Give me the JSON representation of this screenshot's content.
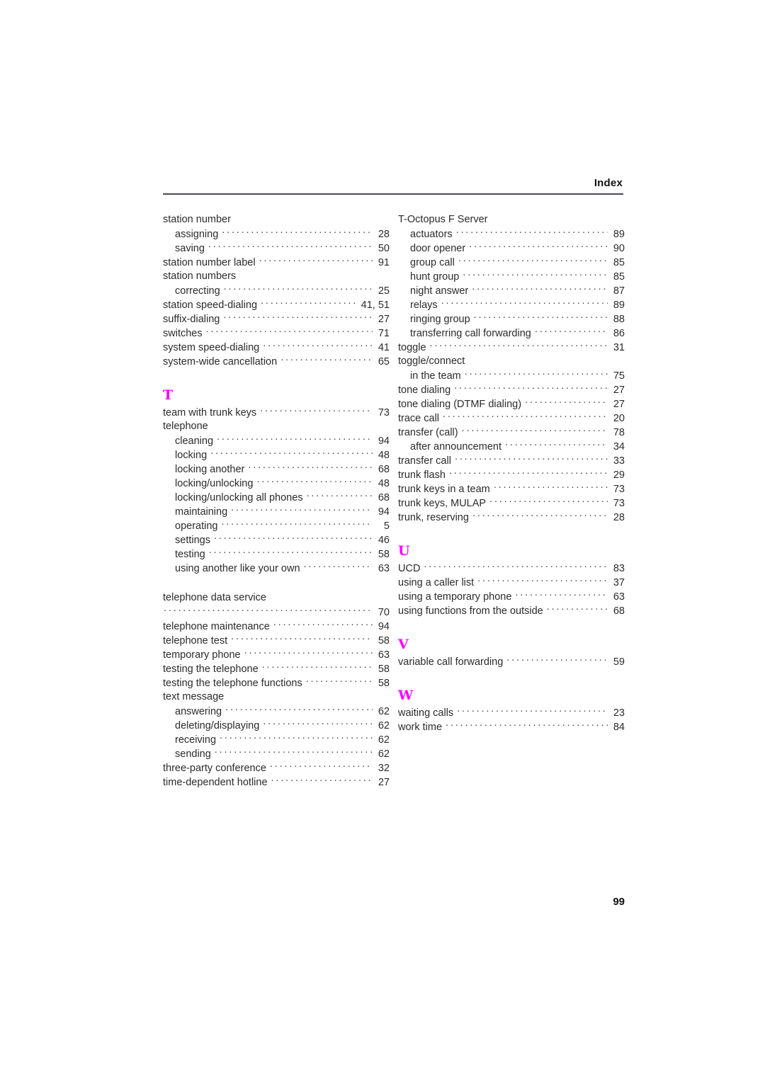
{
  "header": {
    "title": "Index"
  },
  "folio": {
    "page_number": "99"
  },
  "colors": {
    "section_letter": "#ff00ff",
    "rule": "#4a4a50",
    "text": "#2b2b2b"
  },
  "columns": {
    "left": [
      {
        "kind": "entry",
        "level": 0,
        "label": "station number",
        "page": ""
      },
      {
        "kind": "entry",
        "level": 1,
        "label": "assigning",
        "page": "28"
      },
      {
        "kind": "entry",
        "level": 1,
        "label": "saving",
        "page": "50"
      },
      {
        "kind": "entry",
        "level": 0,
        "label": "station number label",
        "page": "91"
      },
      {
        "kind": "entry",
        "level": 0,
        "label": "station numbers",
        "page": ""
      },
      {
        "kind": "entry",
        "level": 1,
        "label": "correcting",
        "page": "25"
      },
      {
        "kind": "entry",
        "level": 0,
        "label": "station speed-dialing",
        "page": "41, 51"
      },
      {
        "kind": "entry",
        "level": 0,
        "label": "suffix-dialing",
        "page": "27"
      },
      {
        "kind": "entry",
        "level": 0,
        "label": "switches",
        "page": "71"
      },
      {
        "kind": "entry",
        "level": 0,
        "label": "system speed-dialing",
        "page": "41"
      },
      {
        "kind": "entry",
        "level": 0,
        "label": "system-wide cancellation",
        "page": "65"
      },
      {
        "kind": "gap"
      },
      {
        "kind": "letter",
        "label": "T"
      },
      {
        "kind": "entry",
        "level": 0,
        "label": "team with trunk keys",
        "page": "73"
      },
      {
        "kind": "entry",
        "level": 0,
        "label": "telephone",
        "page": ""
      },
      {
        "kind": "entry",
        "level": 1,
        "label": "cleaning",
        "page": "94"
      },
      {
        "kind": "entry",
        "level": 1,
        "label": "locking",
        "page": "48"
      },
      {
        "kind": "entry",
        "level": 1,
        "label": "locking another",
        "page": "68"
      },
      {
        "kind": "entry",
        "level": 1,
        "label": "locking/unlocking",
        "page": "48"
      },
      {
        "kind": "entry",
        "level": 1,
        "label": "locking/unlocking all phones",
        "page": "68"
      },
      {
        "kind": "entry",
        "level": 1,
        "label": "maintaining",
        "page": "94"
      },
      {
        "kind": "entry",
        "level": 1,
        "label": "operating",
        "page": "5"
      },
      {
        "kind": "entry",
        "level": 1,
        "label": "settings",
        "page": "46"
      },
      {
        "kind": "entry",
        "level": 1,
        "label": "testing",
        "page": "58"
      },
      {
        "kind": "entry",
        "level": 1,
        "label": "using another like your own",
        "page": "63"
      },
      {
        "kind": "gap-small"
      },
      {
        "kind": "entry",
        "level": 0,
        "label": "telephone data service",
        "page": ""
      },
      {
        "kind": "cont",
        "level": 0,
        "label": "",
        "page": "70"
      },
      {
        "kind": "entry",
        "level": 0,
        "label": "telephone maintenance",
        "page": "94"
      },
      {
        "kind": "entry",
        "level": 0,
        "label": "telephone test",
        "page": "58"
      },
      {
        "kind": "entry",
        "level": 0,
        "label": "temporary phone",
        "page": "63"
      },
      {
        "kind": "entry",
        "level": 0,
        "label": "testing the telephone",
        "page": "58"
      },
      {
        "kind": "entry",
        "level": 0,
        "label": "testing the telephone functions",
        "page": "58"
      },
      {
        "kind": "entry",
        "level": 0,
        "label": "text message",
        "page": ""
      },
      {
        "kind": "entry",
        "level": 1,
        "label": "answering",
        "page": "62"
      },
      {
        "kind": "entry",
        "level": 1,
        "label": "deleting/displaying",
        "page": "62"
      },
      {
        "kind": "entry",
        "level": 1,
        "label": "receiving",
        "page": "62"
      },
      {
        "kind": "entry",
        "level": 1,
        "label": "sending",
        "page": "62"
      },
      {
        "kind": "entry",
        "level": 0,
        "label": "three-party conference",
        "page": "32"
      },
      {
        "kind": "entry",
        "level": 0,
        "label": "time-dependent hotline",
        "page": "27"
      }
    ],
    "right": [
      {
        "kind": "entry",
        "level": 0,
        "label": "T-Octopus F Server",
        "page": ""
      },
      {
        "kind": "entry",
        "level": 1,
        "label": "actuators",
        "page": "89"
      },
      {
        "kind": "entry",
        "level": 1,
        "label": "door opener",
        "page": "90"
      },
      {
        "kind": "entry",
        "level": 1,
        "label": "group call",
        "page": "85"
      },
      {
        "kind": "entry",
        "level": 1,
        "label": "hunt group",
        "page": "85"
      },
      {
        "kind": "entry",
        "level": 1,
        "label": "night answer",
        "page": "87"
      },
      {
        "kind": "entry",
        "level": 1,
        "label": "relays",
        "page": "89"
      },
      {
        "kind": "entry",
        "level": 1,
        "label": "ringing group",
        "page": "88"
      },
      {
        "kind": "entry",
        "level": 1,
        "label": "transferring call forwarding",
        "page": "86"
      },
      {
        "kind": "entry",
        "level": 0,
        "label": "toggle",
        "page": "31"
      },
      {
        "kind": "entry",
        "level": 0,
        "label": "toggle/connect",
        "page": ""
      },
      {
        "kind": "entry",
        "level": 1,
        "label": "in the team",
        "page": "75"
      },
      {
        "kind": "entry",
        "level": 0,
        "label": "tone dialing",
        "page": "27"
      },
      {
        "kind": "entry",
        "level": 0,
        "label": "tone dialing (DTMF dialing)",
        "page": "27"
      },
      {
        "kind": "entry",
        "level": 0,
        "label": "trace call",
        "page": "20"
      },
      {
        "kind": "entry",
        "level": 0,
        "label": "transfer (call)",
        "page": "78"
      },
      {
        "kind": "entry",
        "level": 1,
        "label": "after announcement",
        "page": "34"
      },
      {
        "kind": "entry",
        "level": 0,
        "label": "transfer call",
        "page": "33"
      },
      {
        "kind": "entry",
        "level": 0,
        "label": "trunk flash",
        "page": "29"
      },
      {
        "kind": "entry",
        "level": 0,
        "label": "trunk keys in a team",
        "page": "73"
      },
      {
        "kind": "entry",
        "level": 0,
        "label": "trunk keys, MULAP",
        "page": "73"
      },
      {
        "kind": "entry",
        "level": 0,
        "label": "trunk, reserving",
        "page": "28"
      },
      {
        "kind": "gap"
      },
      {
        "kind": "letter",
        "label": "U"
      },
      {
        "kind": "entry",
        "level": 0,
        "label": "UCD",
        "page": "83"
      },
      {
        "kind": "entry",
        "level": 0,
        "label": "using a caller list",
        "page": "37"
      },
      {
        "kind": "entry",
        "level": 0,
        "label": "using a temporary phone",
        "page": "63"
      },
      {
        "kind": "entry",
        "level": 0,
        "label": "using functions from the outside",
        "page": "68"
      },
      {
        "kind": "gap"
      },
      {
        "kind": "letter",
        "label": "V"
      },
      {
        "kind": "entry",
        "level": 0,
        "label": "variable call forwarding",
        "page": "59"
      },
      {
        "kind": "gap"
      },
      {
        "kind": "letter",
        "label": "W"
      },
      {
        "kind": "entry",
        "level": 0,
        "label": "waiting calls",
        "page": "23"
      },
      {
        "kind": "entry",
        "level": 0,
        "label": "work time",
        "page": "84"
      }
    ]
  }
}
